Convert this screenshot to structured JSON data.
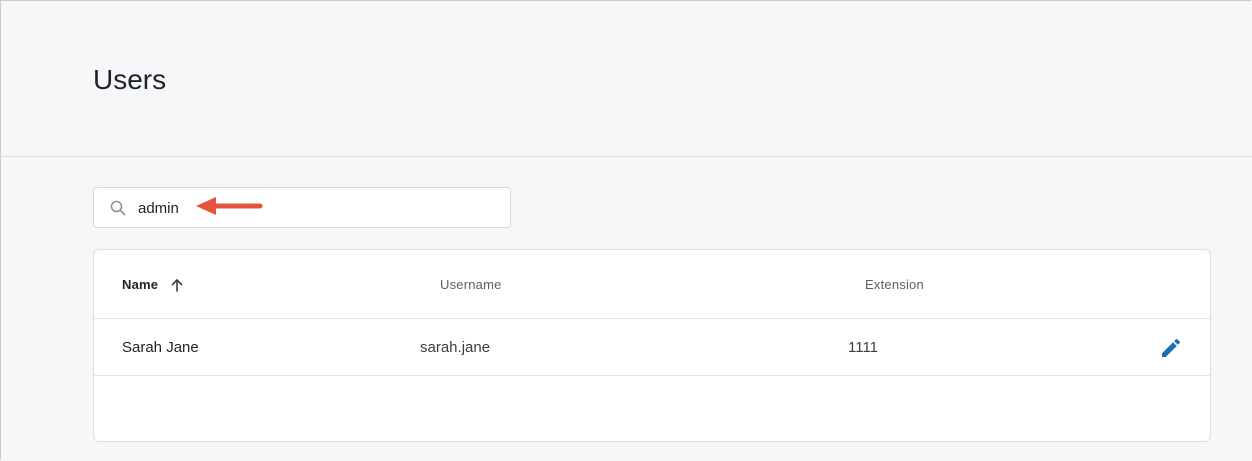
{
  "page": {
    "title": "Users"
  },
  "search": {
    "value": "admin",
    "icon": "search-icon"
  },
  "annotation": {
    "icon": "red-arrow-left-icon",
    "color": "#e5533d"
  },
  "table": {
    "columns": [
      {
        "label": "Name",
        "sort": "ascending",
        "sort_icon": "arrow-up-icon"
      },
      {
        "label": "Username"
      },
      {
        "label": "Extension"
      }
    ],
    "rows": [
      {
        "name": "Sarah Jane",
        "username": "sarah.jane",
        "extension": "1111",
        "action_icon": "edit-pencil-icon"
      }
    ]
  },
  "colors": {
    "accent": "#1f6fb8",
    "background": "#f6f7f9",
    "card": "#ffffff"
  }
}
